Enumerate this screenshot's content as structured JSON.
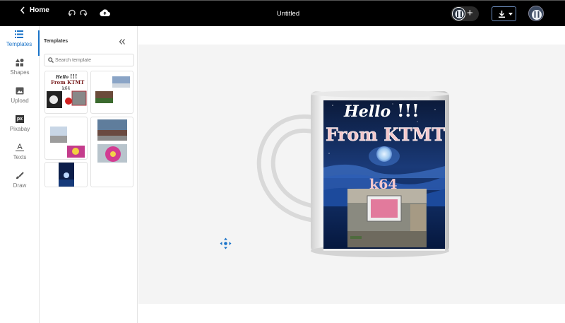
{
  "topbar": {
    "home_label": "Home",
    "title": "Untitled",
    "icons": [
      "back-chevron-icon",
      "undo-icon",
      "redo-icon",
      "cloud-upload-icon",
      "download-icon"
    ]
  },
  "nav": [
    {
      "label": "Templates",
      "icon": "list-icon",
      "active": true
    },
    {
      "label": "Shapes",
      "icon": "shapes-icon"
    },
    {
      "label": "Upload",
      "icon": "image-icon"
    },
    {
      "label": "Pixabay",
      "icon": "pixabay-icon",
      "glyph": "px"
    },
    {
      "label": "Texts",
      "icon": "text-icon",
      "glyph": "A"
    },
    {
      "label": "Draw",
      "icon": "brush-icon"
    }
  ],
  "panel": {
    "title": "Templates",
    "search_placeholder": "Search template"
  },
  "template1": {
    "line1": "Hello",
    "mark": "!!!",
    "line2": "From KTMT",
    "line3": "k64"
  },
  "mug": {
    "line1": "Hello",
    "mark": "!!!",
    "line2": "From KTMT",
    "line3": "k64"
  },
  "colors": {
    "topbar": "#000000",
    "accent": "#1a73c8",
    "canvas": "#f4f4f4"
  }
}
